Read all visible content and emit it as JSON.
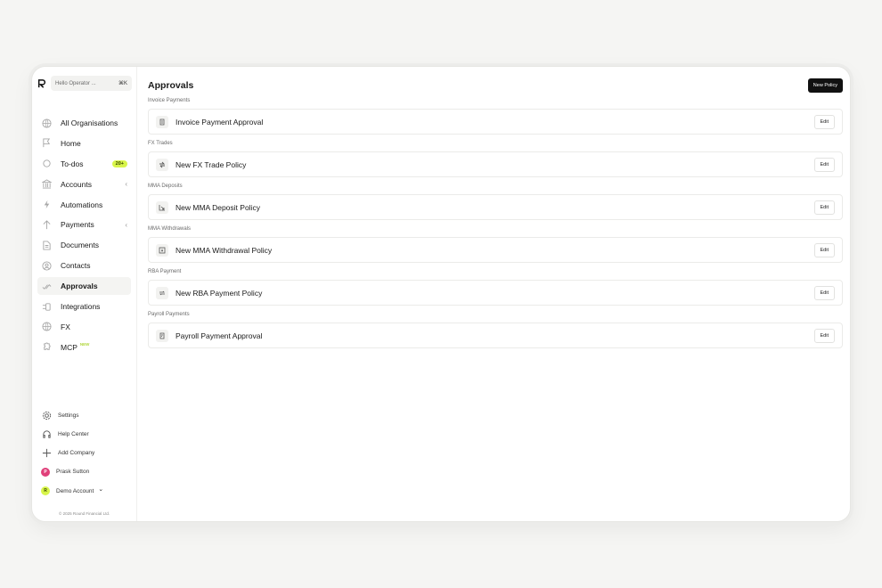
{
  "search": {
    "placeholder": "Hello Operator ...",
    "shortcut": "⌘K"
  },
  "sidebar": {
    "items": [
      {
        "label": "All Organisations",
        "icon": "globe-icon"
      },
      {
        "label": "Home",
        "icon": "flag-icon"
      },
      {
        "label": "To-dos",
        "icon": "circle-icon",
        "badge": "20+"
      },
      {
        "label": "Accounts",
        "icon": "bank-icon",
        "chevron": "‹"
      },
      {
        "label": "Automations",
        "icon": "bolt-icon"
      },
      {
        "label": "Payments",
        "icon": "arrow-up-icon",
        "chevron": "‹"
      },
      {
        "label": "Documents",
        "icon": "document-icon"
      },
      {
        "label": "Contacts",
        "icon": "user-circle-icon"
      },
      {
        "label": "Approvals",
        "icon": "check-icon",
        "active": true
      },
      {
        "label": "Integrations",
        "icon": "integration-icon"
      },
      {
        "label": "FX",
        "icon": "globe-icon"
      },
      {
        "label": "MCP",
        "icon": "puzzle-icon",
        "tag": "NEW"
      }
    ],
    "bottom": {
      "settings": "Settings",
      "help": "Help Center",
      "add_company": "Add Company",
      "user": {
        "name": "Prask Sutton",
        "initial": "P",
        "color": "#e0407a"
      },
      "account": {
        "name": "Demo Account",
        "initial": "R",
        "color": "#d8f54a",
        "chevron": "⌄"
      }
    },
    "copyright": "© 2025 Round Financial Ltd."
  },
  "main": {
    "title": "Approvals",
    "new_policy": "New Policy",
    "edit_label": "Edit",
    "sections": [
      {
        "label": "Invoice Payments",
        "policy": "Invoice Payment Approval",
        "icon": "invoice-icon"
      },
      {
        "label": "FX Trades",
        "policy": "New FX Trade Policy",
        "icon": "fx-icon"
      },
      {
        "label": "MMA Deposits",
        "policy": "New MMA Deposit Policy",
        "icon": "deposit-icon"
      },
      {
        "label": "MMA Withdrawals",
        "policy": "New MMA Withdrawal Policy",
        "icon": "withdrawal-icon"
      },
      {
        "label": "RBA Payment",
        "policy": "New RBA Payment Policy",
        "icon": "transfer-icon"
      },
      {
        "label": "Payroll Payments",
        "policy": "Payroll Payment Approval",
        "icon": "payroll-icon"
      }
    ]
  }
}
